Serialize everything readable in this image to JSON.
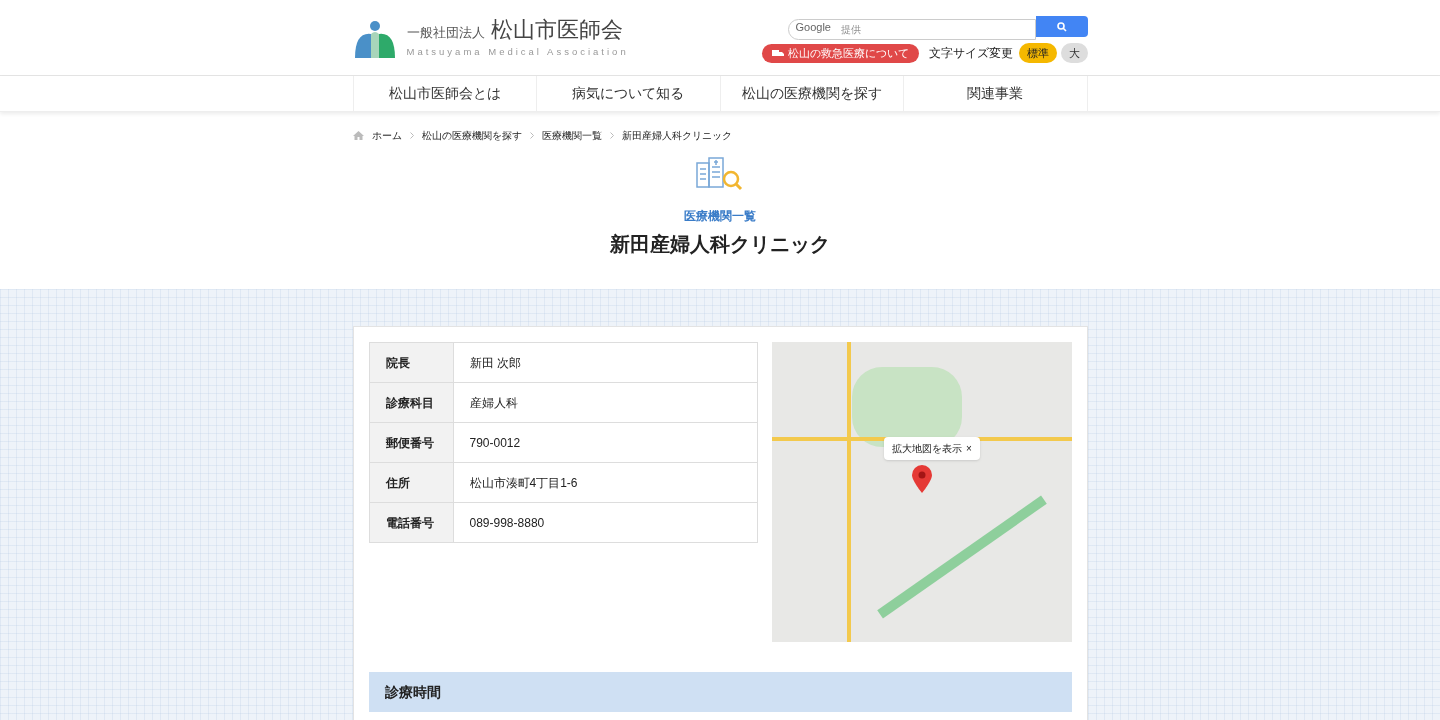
{
  "header": {
    "logo_prefix": "一般社団法人",
    "logo_title": "松山市医師会",
    "logo_subtitle": "Matsuyama Medical Association",
    "search": {
      "placeholder": "提供",
      "brand": "Google"
    },
    "emergency_link": "松山の救急医療について",
    "font_size_label": "文字サイズ変更",
    "font_sizes": [
      {
        "label": "標準",
        "selected": true
      },
      {
        "label": "大",
        "selected": false
      }
    ]
  },
  "nav": [
    "松山市医師会とは",
    "病気について知る",
    "松山の医療機関を探す",
    "関連事業"
  ],
  "breadcrumb": [
    "ホーム",
    "松山の医療機関を探す",
    "医療機関一覧",
    "新田産婦人科クリニック"
  ],
  "page": {
    "category": "医療機関一覧",
    "title": "新田産婦人科クリニック"
  },
  "info": [
    {
      "label": "院長",
      "value": "新田 次郎"
    },
    {
      "label": "診療科目",
      "value": "産婦人科"
    },
    {
      "label": "郵便番号",
      "value": "790-0012"
    },
    {
      "label": "住所",
      "value": "松山市湊町4丁目1-6"
    },
    {
      "label": "電話番号",
      "value": "089-998-8880"
    }
  ],
  "map": {
    "tooltip": "拡大地図を表示",
    "close": "×"
  },
  "section_heading": "診療時間"
}
